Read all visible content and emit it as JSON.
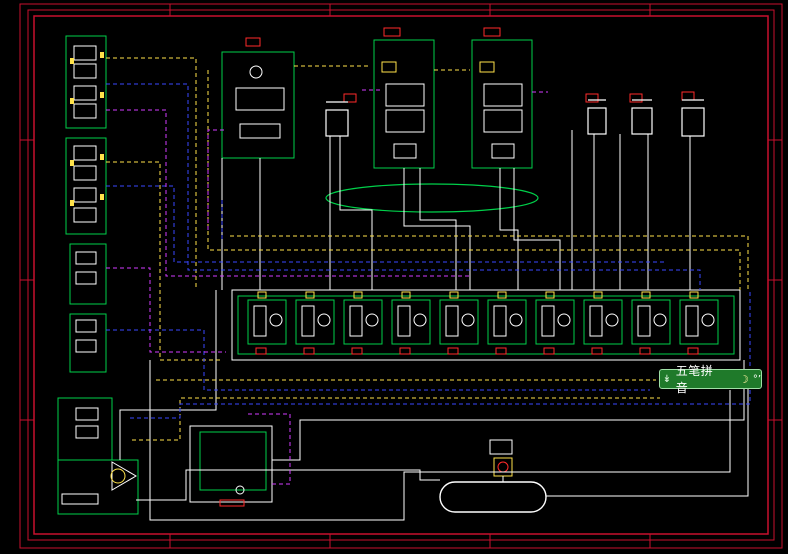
{
  "colors": {
    "background": "#000000",
    "frame": "#c8102e",
    "pressure_line": "#ffffff",
    "return_line": "#ffe24a",
    "pilot_line": "#3a48ff",
    "drain_line": "#d23cff",
    "component": "#00d04a",
    "accent": "#ff2a2a"
  },
  "ime_bar": {
    "collapse_icon": "chevron-double-down-icon",
    "name": "五笔拼音",
    "mode_icon": "moon-icon",
    "punct_icon": "punctuation-icon"
  }
}
